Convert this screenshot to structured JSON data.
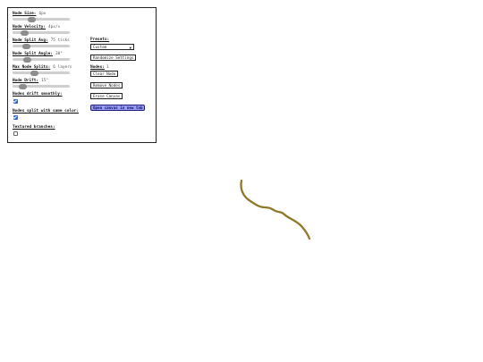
{
  "controls": {
    "node_size": {
      "label": "Node Size:",
      "value": "6px",
      "fraction": 0.3
    },
    "node_velocity": {
      "label": "Node Velocity:",
      "value": "4px/s",
      "fraction": 0.17
    },
    "node_split_avg": {
      "label": "Node Split Avg:",
      "value": "75 ticks",
      "fraction": 0.2
    },
    "node_split_angle": {
      "label": "Node Split Angle:",
      "value": "30°",
      "fraction": 0.22
    },
    "max_node_splits": {
      "label": "Max Node Splits:",
      "value": "6 layers",
      "fraction": 0.37
    },
    "node_drift": {
      "label": "Node Drift:",
      "value": "15°",
      "fraction": 0.13
    },
    "drift_smoothly": {
      "label": "Nodes drift smoothly:",
      "checked": true
    },
    "split_same_color": {
      "label": "Nodes split with same color:",
      "checked": true
    },
    "textured_branches": {
      "label": "Textured branches:",
      "checked": false
    }
  },
  "presets": {
    "label": "Presets:",
    "selected": "Custom"
  },
  "nodes_count": {
    "label": "Nodes:",
    "value": "1"
  },
  "buttons": {
    "randomize": "Randomize Settings",
    "clear_node": "Clear Node",
    "remove_nodes": "Remove Nodes",
    "erase_canvas": "Erase Canvas",
    "open_new_tab": "Open canvas in new tab"
  },
  "branch_color": "#8f7a2a",
  "accent_color": "#9a9ff4"
}
